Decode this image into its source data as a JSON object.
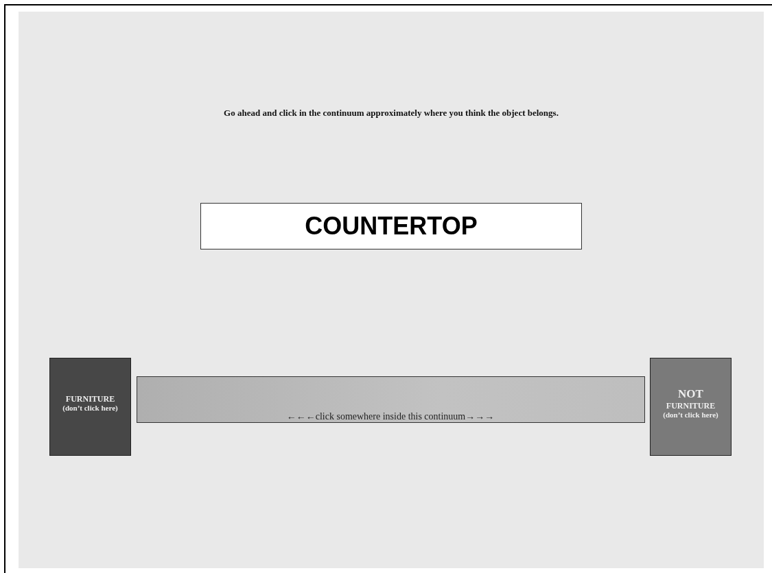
{
  "instruction": "Go ahead and click in the continuum approximately where you think the object belongs.",
  "word": "COUNTERTOP",
  "left_category": {
    "title": "FURNITURE",
    "note": "(don’t click here)"
  },
  "continuum": {
    "label": "←←←click somewhere inside this continuum→→→"
  },
  "right_category": {
    "title_lines": [
      "NOT",
      "FURNITURE"
    ],
    "note": "(don’t click here)"
  }
}
